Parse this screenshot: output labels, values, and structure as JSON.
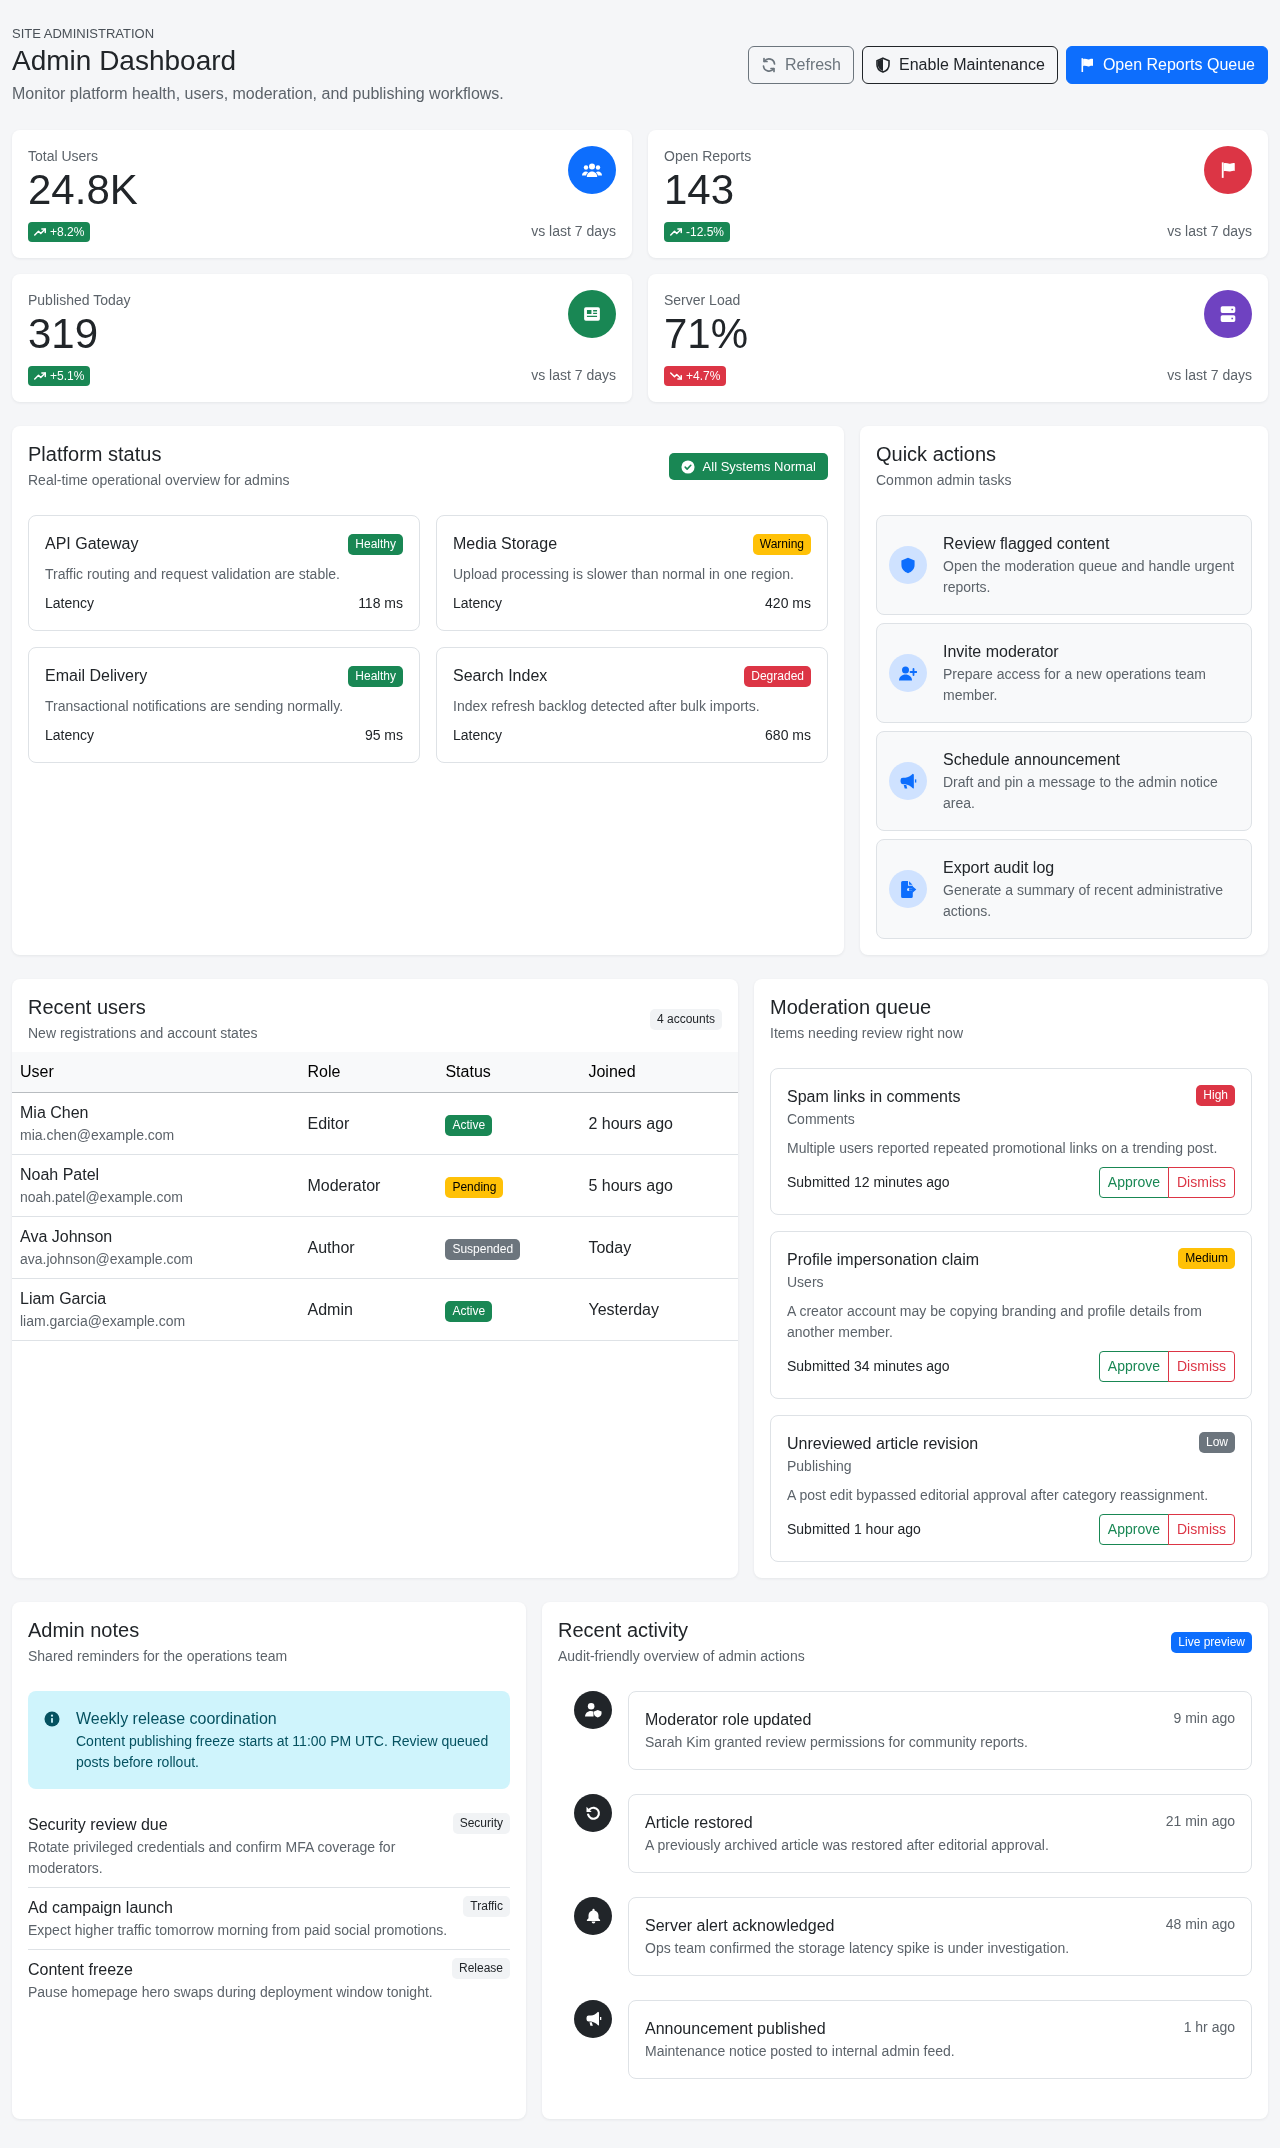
{
  "header": {
    "eyebrow": "SITE ADMINISTRATION",
    "title": "Admin Dashboard",
    "subtitle": "Monitor platform health, users, moderation, and publishing workflows.",
    "buttons": [
      {
        "kind": "refresh",
        "label": "Refresh"
      },
      {
        "kind": "maintenance",
        "label": "Enable Maintenance"
      },
      {
        "kind": "reports",
        "label": "Open Reports Queue"
      }
    ]
  },
  "stats": [
    {
      "kind": "users",
      "label": "Total Users",
      "value": "24.8K",
      "change": "+8.2%",
      "trend_up": true,
      "period": "vs last 7 days",
      "color": "#0d6efd"
    },
    {
      "kind": "reports",
      "label": "Open Reports",
      "value": "143",
      "change": "-12.5%",
      "trend_up": true,
      "period": "vs last 7 days",
      "color": "#dc3545"
    },
    {
      "kind": "published",
      "label": "Published Today",
      "value": "319",
      "change": "+5.1%",
      "trend_up": true,
      "period": "vs last 7 days",
      "color": "#198754"
    },
    {
      "kind": "server",
      "label": "Server Load",
      "value": "71%",
      "change": "+4.7%",
      "trend_up": false,
      "period": "vs last 7 days",
      "color": "#6f42c1"
    }
  ],
  "platform_status": {
    "title": "Platform status",
    "subtitle": "Real-time operational overview for admins",
    "overall": "All Systems Normal",
    "services": [
      {
        "name": "API Gateway",
        "status": "Healthy",
        "color": "#198754",
        "description": "Traffic routing and request validation are stable.",
        "metric_label": "Latency",
        "metric_value": "118 ms"
      },
      {
        "name": "Media Storage",
        "status": "Warning",
        "color": "#ffc107",
        "description": "Upload processing is slower than normal in one region.",
        "metric_label": "Latency",
        "metric_value": "420 ms"
      },
      {
        "name": "Email Delivery",
        "status": "Healthy",
        "color": "#198754",
        "description": "Transactional notifications are sending normally.",
        "metric_label": "Latency",
        "metric_value": "95 ms"
      },
      {
        "name": "Search Index",
        "status": "Degraded",
        "color": "#dc3545",
        "description": "Index refresh backlog detected after bulk imports.",
        "metric_label": "Latency",
        "metric_value": "680 ms"
      }
    ]
  },
  "quick_actions": {
    "title": "Quick actions",
    "subtitle": "Common admin tasks",
    "items": [
      {
        "kind": "review",
        "title": "Review flagged content",
        "description": "Open the moderation queue and handle urgent reports."
      },
      {
        "kind": "invite",
        "title": "Invite moderator",
        "description": "Prepare access for a new operations team member."
      },
      {
        "kind": "announce",
        "title": "Schedule announcement",
        "description": "Draft and pin a message to the admin notice area."
      },
      {
        "kind": "export",
        "title": "Export audit log",
        "description": "Generate a summary of recent administrative actions."
      }
    ]
  },
  "recent_users": {
    "title": "Recent users",
    "subtitle": "New registrations and account states",
    "count": "4 accounts",
    "columns": [
      "User",
      "Role",
      "Status",
      "Joined"
    ],
    "rows": [
      {
        "name": "Mia Chen",
        "email": "mia.chen@example.com",
        "role": "Editor",
        "status": "Active",
        "color": "#198754",
        "joined": "2 hours ago"
      },
      {
        "name": "Noah Patel",
        "email": "noah.patel@example.com",
        "role": "Moderator",
        "status": "Pending",
        "color": "#ffc107",
        "joined": "5 hours ago"
      },
      {
        "name": "Ava Johnson",
        "email": "ava.johnson@example.com",
        "role": "Author",
        "status": "Suspended",
        "color": "#6c757d",
        "joined": "Today"
      },
      {
        "name": "Liam Garcia",
        "email": "liam.garcia@example.com",
        "role": "Admin",
        "status": "Active",
        "color": "#198754",
        "joined": "Yesterday"
      }
    ]
  },
  "moderation_queue": {
    "title": "Moderation queue",
    "subtitle": "Items needing review right now",
    "items": [
      {
        "title": "Spam links in comments",
        "category": "Comments",
        "priority": "High",
        "color": "#dc3545",
        "description": "Multiple users reported repeated promotional links on a trending post.",
        "submitted": "Submitted 12 minutes ago",
        "actions": [
          {
            "kind": "approve",
            "label": "Approve"
          },
          {
            "kind": "dismiss",
            "label": "Dismiss"
          }
        ]
      },
      {
        "title": "Profile impersonation claim",
        "category": "Users",
        "priority": "Medium",
        "color": "#ffc107",
        "description": "A creator account may be copying branding and profile details from another member.",
        "submitted": "Submitted 34 minutes ago",
        "actions": [
          {
            "kind": "approve",
            "label": "Approve"
          },
          {
            "kind": "dismiss",
            "label": "Dismiss"
          }
        ]
      },
      {
        "title": "Unreviewed article revision",
        "category": "Publishing",
        "priority": "Low",
        "color": "#6c757d",
        "description": "A post edit bypassed editorial approval after category reassignment.",
        "submitted": "Submitted 1 hour ago",
        "actions": [
          {
            "kind": "approve",
            "label": "Approve"
          },
          {
            "kind": "dismiss",
            "label": "Dismiss"
          }
        ]
      }
    ]
  },
  "admin_notes": {
    "title": "Admin notes",
    "subtitle": "Shared reminders for the operations team",
    "alert": {
      "title": "Weekly release coordination",
      "body": "Content publishing freeze starts at 11:00 PM UTC. Review queued posts before rollout."
    },
    "notes": [
      {
        "title": "Security review due",
        "tag": "Security",
        "description": "Rotate privileged credentials and confirm MFA coverage for moderators."
      },
      {
        "title": "Ad campaign launch",
        "tag": "Traffic",
        "description": "Expect higher traffic tomorrow morning from paid social promotions."
      },
      {
        "title": "Content freeze",
        "tag": "Release",
        "description": "Pause homepage hero swaps during deployment window tonight."
      }
    ]
  },
  "recent_activity": {
    "title": "Recent activity",
    "subtitle": "Audit-friendly overview of admin actions",
    "badge": "Live preview",
    "items": [
      {
        "kind": "role",
        "title": "Moderator role updated",
        "description": "Sarah Kim granted review permissions for community reports.",
        "time": "9 min ago"
      },
      {
        "kind": "restore",
        "title": "Article restored",
        "description": "A previously archived article was restored after editorial approval.",
        "time": "21 min ago"
      },
      {
        "kind": "alert",
        "title": "Server alert acknowledged",
        "description": "Ops team confirmed the storage latency spike is under investigation.",
        "time": "48 min ago"
      },
      {
        "kind": "announce",
        "title": "Announcement published",
        "description": "Maintenance notice posted to internal admin feed.",
        "time": "1 hr ago"
      }
    ]
  }
}
